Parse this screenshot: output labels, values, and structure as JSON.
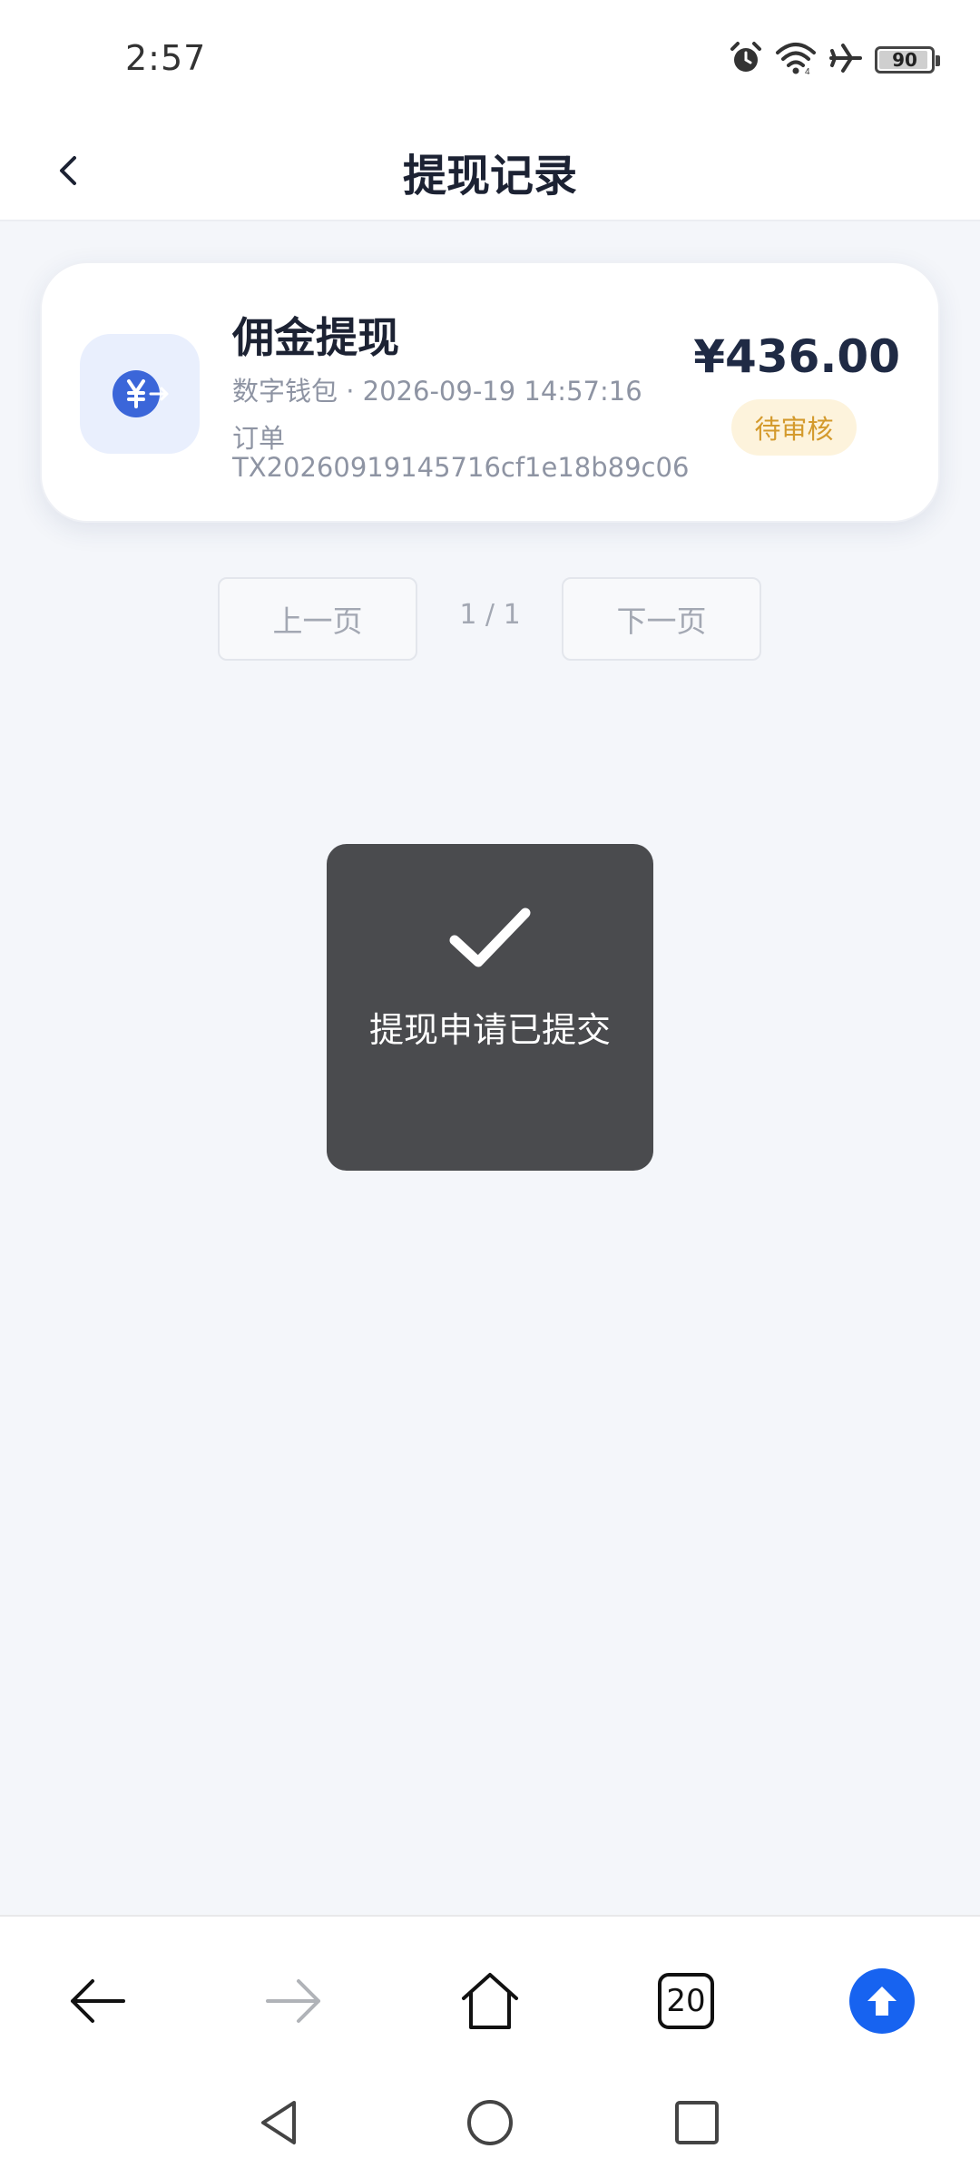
{
  "status_bar": {
    "time": "2:57",
    "battery": "90",
    "icons": [
      "alarm-icon",
      "wifi-icon",
      "airplane-icon",
      "battery-icon"
    ]
  },
  "header": {
    "title": "提现记录",
    "back_icon": "chevron-left-icon"
  },
  "record": {
    "title": "佣金提现",
    "meta": "数字钱包 · 2026-09-19 14:57:16",
    "order_label": "订单",
    "order_no": "TX20260919145716cf1e18b89c06",
    "amount": "¥436.00",
    "status": "待审核",
    "icon": "yuan-transfer-icon"
  },
  "pagination": {
    "prev_label": "上一页",
    "page_info": "1 / 1",
    "next_label": "下一页"
  },
  "toast": {
    "icon": "checkmark-icon",
    "message": "提现申请已提交"
  },
  "browser_toolbar": {
    "tab_count": "20",
    "icons": [
      "back-arrow-icon",
      "forward-arrow-icon",
      "home-icon",
      "tabs-icon",
      "scroll-up-icon"
    ]
  },
  "system_nav": {
    "icons": [
      "triangle-back-icon",
      "circle-home-icon",
      "square-recents-icon"
    ]
  },
  "colors": {
    "accent_blue": "#1763f0",
    "icon_blue": "#3b66d9",
    "pending_text": "#d49a2c",
    "pending_bg": "#fdf3dc",
    "toast_bg": "#4a4b4e",
    "page_bg": "#f4f6fa"
  }
}
